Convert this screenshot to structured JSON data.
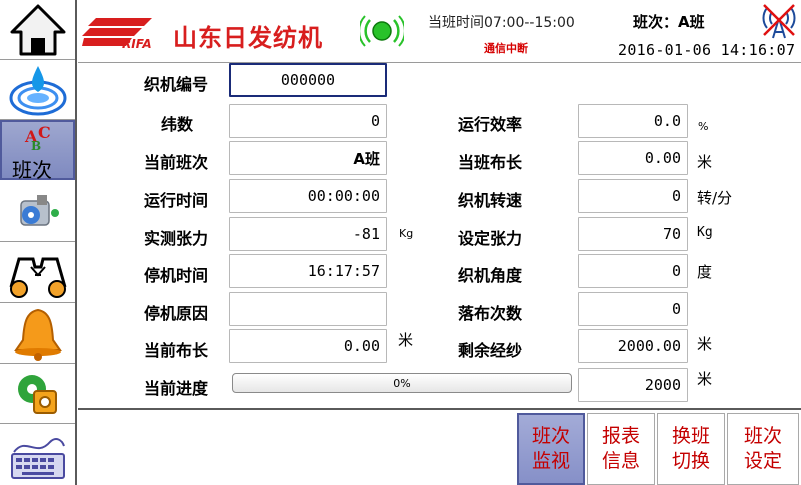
{
  "header": {
    "company": "山东日发纺机",
    "brand": "RIFA",
    "shift_time": "当班时间07:00--15:00",
    "shift_label": "班次：A班",
    "comm_status": "通信中断",
    "datetime": "2016-01-06 14:16:07"
  },
  "sidebar": {
    "active_label": "班次",
    "items": [
      {
        "icon": "home-icon"
      },
      {
        "icon": "water-drop-icon"
      },
      {
        "icon": "shift-abc-icon"
      },
      {
        "icon": "fan-icon"
      },
      {
        "icon": "loom-machine-icon"
      },
      {
        "icon": "alarm-bell-icon"
      },
      {
        "icon": "settings-gears-icon"
      },
      {
        "icon": "keyboard-icon"
      }
    ]
  },
  "fields": {
    "loom_no": {
      "label": "织机编号",
      "value": "000000"
    },
    "weft": {
      "label": "纬数",
      "value": "0"
    },
    "cur_shift": {
      "label": "当前班次",
      "value": "A班"
    },
    "run_time": {
      "label": "运行时间",
      "value": "00:00:00"
    },
    "tension": {
      "label": "实测张力",
      "value": "-81",
      "unit": "Kg"
    },
    "stop_time": {
      "label": "停机时间",
      "value": "16:17:57"
    },
    "stop_reason": {
      "label": "停机原因",
      "value": ""
    },
    "cur_length": {
      "label": "当前布长",
      "value": "0.00",
      "unit": "米"
    },
    "progress": {
      "label": "当前进度",
      "value": "0%",
      "percent": 0,
      "total": "2000",
      "unit": "米"
    },
    "efficiency": {
      "label": "运行效率",
      "value": "0.0",
      "unit": "%"
    },
    "shift_length": {
      "label": "当班布长",
      "value": "0.00",
      "unit": "米"
    },
    "speed": {
      "label": "织机转速",
      "value": "0",
      "unit": "转/分"
    },
    "set_tension": {
      "label": "设定张力",
      "value": "70",
      "unit": "Kg"
    },
    "angle": {
      "label": "织机角度",
      "value": "0",
      "unit": "度"
    },
    "doff_count": {
      "label": "落布次数",
      "value": "0"
    },
    "remain_warp": {
      "label": "剩余经纱",
      "value": "2000.00",
      "unit": "米"
    }
  },
  "nav": {
    "shift_monitor": "班次\n监视",
    "report_info": "报表\n信息",
    "shift_switch": "换班\n切换",
    "shift_setting": "班次\n设定"
  },
  "colors": {
    "brand_red": "#d81e1e",
    "active_bg": "#8690c8",
    "nav_text": "#c40000",
    "comm_alert": "#d50000"
  }
}
